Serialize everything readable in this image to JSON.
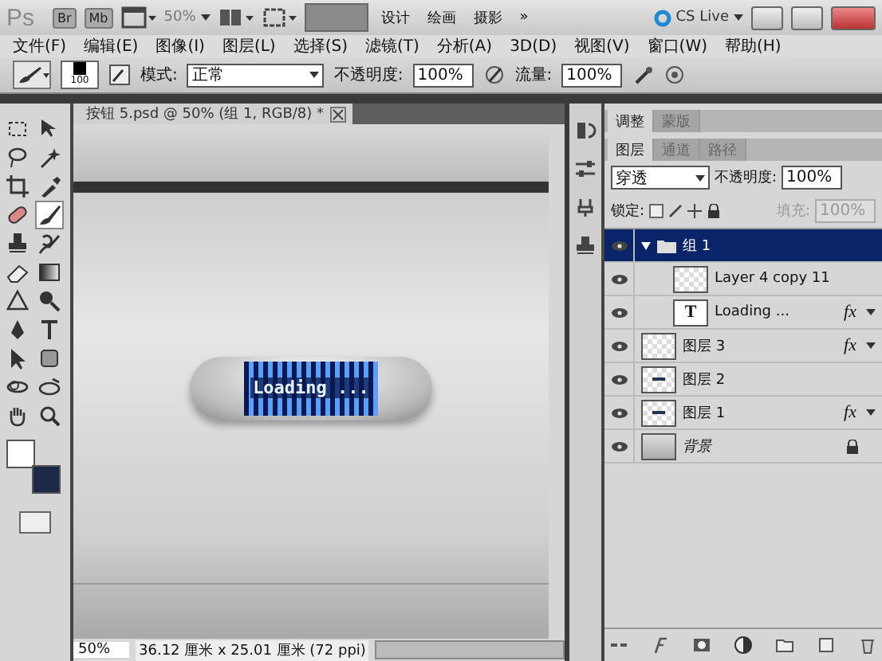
{
  "app_bar": {
    "logo": "Ps",
    "bridge": "Br",
    "mini_bridge": "Mb",
    "zoom": "50%",
    "workspaces": [
      {
        "label": "设计"
      },
      {
        "label": "绘画"
      },
      {
        "label": "摄影"
      }
    ],
    "more": "»",
    "cs_live": "CS Live"
  },
  "menu": [
    "文件(F)",
    "编辑(E)",
    "图像(I)",
    "图层(L)",
    "选择(S)",
    "滤镜(T)",
    "分析(A)",
    "3D(D)",
    "视图(V)",
    "窗口(W)",
    "帮助(H)"
  ],
  "options": {
    "brush_size": "100",
    "mode_label": "模式:",
    "mode": "正常",
    "opacity_label": "不透明度:",
    "opacity": "100%",
    "flow_label": "流量:",
    "flow": "100%"
  },
  "tools": [
    {
      "kind": "marquee",
      "selected": false
    },
    {
      "kind": "move",
      "selected": false
    },
    {
      "kind": "lasso",
      "selected": false
    },
    {
      "kind": "wand",
      "selected": false
    },
    {
      "kind": "crop",
      "selected": false
    },
    {
      "kind": "eyedropper",
      "selected": false
    },
    {
      "kind": "healing",
      "selected": false
    },
    {
      "kind": "brush",
      "selected": true
    },
    {
      "kind": "stamp",
      "selected": false
    },
    {
      "kind": "history",
      "selected": false
    },
    {
      "kind": "eraser",
      "selected": false
    },
    {
      "kind": "gradient",
      "selected": false
    },
    {
      "kind": "blur",
      "selected": false
    },
    {
      "kind": "dodge",
      "selected": false
    },
    {
      "kind": "pen",
      "selected": false
    },
    {
      "kind": "type",
      "selected": false
    },
    {
      "kind": "arrow",
      "selected": false
    },
    {
      "kind": "shape",
      "selected": false
    },
    {
      "kind": "rotate3d",
      "selected": false
    },
    {
      "kind": "orbit3d",
      "selected": false
    },
    {
      "kind": "hand",
      "selected": false
    },
    {
      "kind": "zoom",
      "selected": false
    }
  ],
  "document": {
    "tab": "按钮 5.psd @ 50% (组 1, RGB/8) *",
    "button_text": "Loading ...",
    "zoom": "50%",
    "info": "36.12 厘米 x 25.01 厘米 (72 ppi)"
  },
  "panels": {
    "top_tabs": [
      {
        "label": "调整",
        "selected": true
      },
      {
        "label": "蒙版",
        "selected": false
      }
    ],
    "layer_tabs": [
      {
        "label": "图层",
        "selected": true
      },
      {
        "label": "通道",
        "selected": false
      },
      {
        "label": "路径",
        "selected": false
      }
    ],
    "blend_mode": "穿透",
    "opacity_label": "不透明度:",
    "opacity": "100%",
    "lock_label": "锁定:",
    "fill_label": "填充:",
    "fill": "100%",
    "fill_disabled": true,
    "layers": [
      {
        "name": "组 1",
        "kind": "group",
        "visible": true,
        "selected": true,
        "expanded": true,
        "children": [
          {
            "name": "Layer 4 copy 11",
            "kind": "pixel",
            "visible": true,
            "selected": false
          },
          {
            "name": "Loading ...",
            "kind": "text",
            "thumb_text": "T",
            "visible": true,
            "selected": false,
            "effects": "fx"
          }
        ]
      },
      {
        "name": "图层 3",
        "kind": "pixel",
        "visible": true,
        "selected": false,
        "effects": "fx"
      },
      {
        "name": "图层 2",
        "kind": "line",
        "visible": true,
        "selected": false
      },
      {
        "name": "图层 1",
        "kind": "line",
        "visible": true,
        "selected": false,
        "effects": "fx"
      },
      {
        "name": "背景",
        "kind": "background",
        "visible": true,
        "selected": false,
        "locked": true
      }
    ]
  }
}
